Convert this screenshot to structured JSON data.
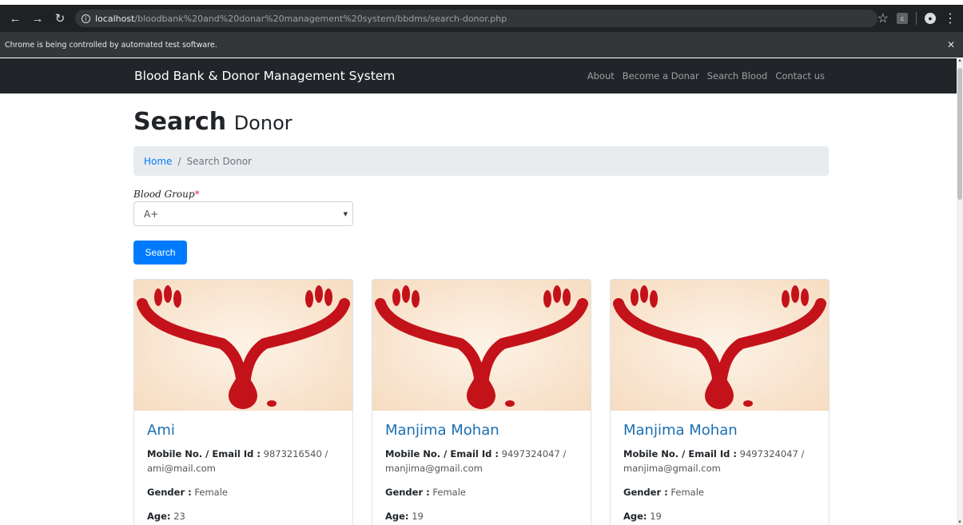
{
  "browser": {
    "url_host": "localhost",
    "url_path": "/bloodbank%20and%20donar%20management%20system/bbdms/search-donor.php",
    "ext_label": "c",
    "infobar_text": "Chrome is being controlled by automated test software."
  },
  "navbar": {
    "brand": "Blood Bank & Donor Management System",
    "links": [
      "About",
      "Become a Donar",
      "Search Blood",
      "Contact us"
    ]
  },
  "page": {
    "title_bold": "Search",
    "title_rest": "Donor",
    "breadcrumb_home": "Home",
    "breadcrumb_sep": "/",
    "breadcrumb_current": "Search Donor"
  },
  "form": {
    "blood_group_label": "Blood Group",
    "required_mark": "*",
    "blood_group_value": "A+",
    "search_button": "Search"
  },
  "labels": {
    "contact": "Mobile No. / Email Id :",
    "gender": "Gender :",
    "age": "Age:"
  },
  "donors": [
    {
      "name": "Ami",
      "mobile": "9873216540",
      "sep": "/",
      "email": "ami@mail.com",
      "gender": "Female",
      "age": "23"
    },
    {
      "name": "Manjima Mohan",
      "mobile": "9497324047",
      "sep": "/",
      "email": "manjima@gmail.com",
      "gender": "Female",
      "age": "19"
    },
    {
      "name": "Manjima Mohan",
      "mobile": "9497324047",
      "sep": "/",
      "email": "manjima@gmail.com",
      "gender": "Female",
      "age": "19"
    }
  ],
  "colors": {
    "accent": "#007bff",
    "navbar": "#212529",
    "blood_red": "#c4121a"
  }
}
